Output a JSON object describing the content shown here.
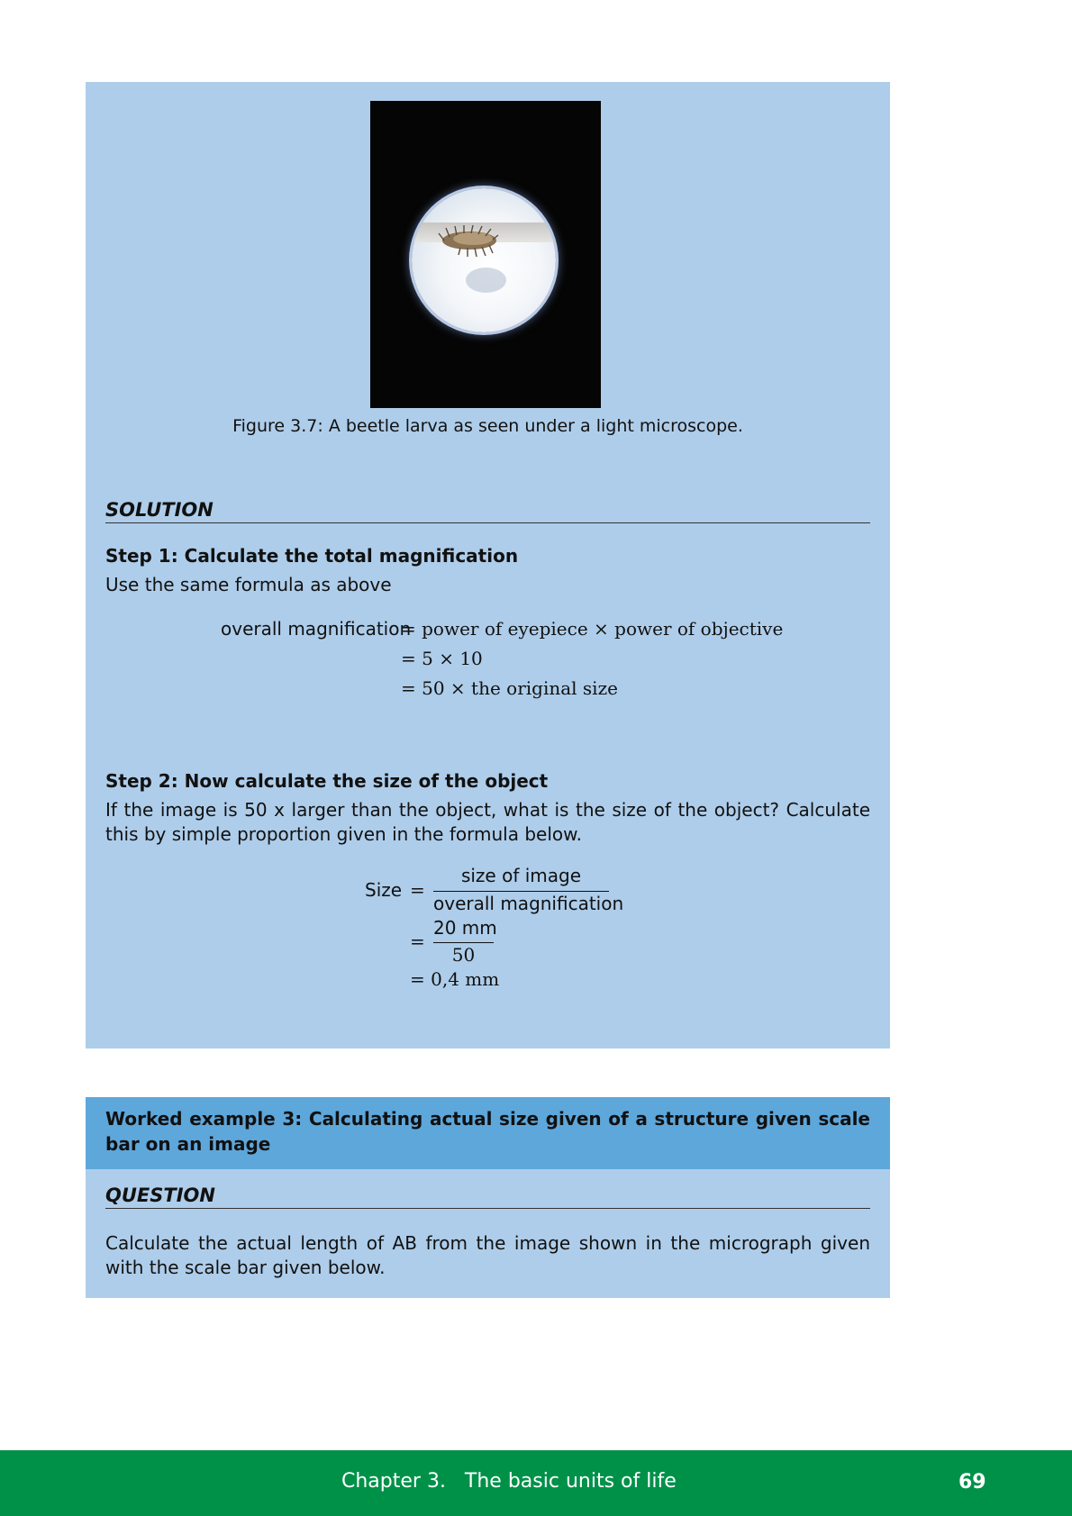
{
  "figure": {
    "image_alt": "beetle-larva-micrograph",
    "caption": "Figure 3.7: A beetle larva as seen under a light microscope."
  },
  "solution": {
    "heading": "SOLUTION",
    "step1": {
      "title": "Step 1: Calculate the total magnification",
      "text": "Use the same formula as above",
      "eq_line1_lhs": "overall magnification",
      "eq_line1_rhs": "= power of eyepiece × power of objective",
      "eq_line2": "= 5 × 10",
      "eq_line3": "= 50 × the original size"
    },
    "step2": {
      "title": "Step 2: Now calculate the size of the object",
      "text": "If the image is 50 x larger than the object, what is the size of the object? Calculate this by simple proportion given in the formula below.",
      "lhs": "Size",
      "eq": "=",
      "frac1_num": "size of image",
      "frac1_den": "overall magnification",
      "frac2_num": "20 mm",
      "frac2_den": "50",
      "result": "= 0,4 mm"
    }
  },
  "worked_example": {
    "heading": "Worked example 3: Calculating actual size given of a structure given scale bar on an image",
    "question_heading": "QUESTION",
    "question_text": "Calculate the actual length of AB from the image shown in the micrograph given with the scale bar given below."
  },
  "footer": {
    "chapter": "Chapter 3.   The basic units of life",
    "page_number": "69"
  },
  "colors": {
    "box_bg": "#aecdea",
    "header_bg": "#5ea7db",
    "footer_bg": "#009149"
  }
}
